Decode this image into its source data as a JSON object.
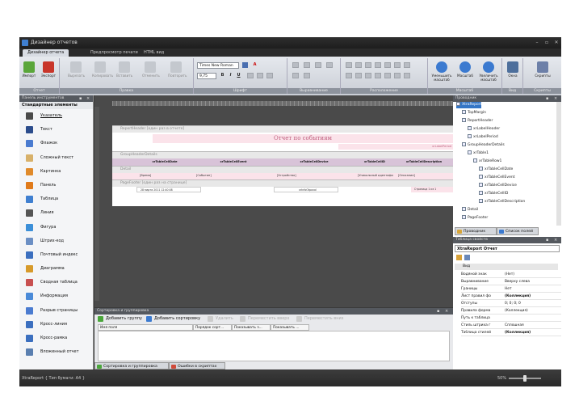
{
  "window": {
    "title": "Дизайнер отчетов",
    "controls": [
      "–",
      "▫",
      "✕"
    ]
  },
  "ribbon_tabs": [
    {
      "label": "Дизайнер отчета",
      "active": true
    },
    {
      "label": "Предпросмотр печати",
      "active": false
    },
    {
      "label": "HTML вид",
      "active": false
    }
  ],
  "ribbon": {
    "groups": {
      "report": "Отчет",
      "edit": "Правка",
      "font": "Шрифт",
      "align": "Выравнивание",
      "layout": "Расположение",
      "zoom": "Масштаб",
      "view": "Вид",
      "scripts": "Скрипты"
    },
    "buttons": {
      "import": "Импорт",
      "export": "Экспорт",
      "cut": "Вырезать",
      "copy": "Копировать",
      "paste": "Вставить",
      "undo": "Отменить",
      "redo": "Повторить",
      "zoom_out": "Уменьшить масштаб",
      "zoom": "Масштаб",
      "zoom_in": "Увеличить масштаб",
      "windows": "Окна",
      "scripts": "Скрипты"
    },
    "font_name": "Times New Roman",
    "font_size": "9,75",
    "style_buttons": [
      "B",
      "I",
      "U"
    ]
  },
  "toolbox": {
    "pane_title": "Панель инструментов",
    "header": "Стандартные элементы",
    "items": [
      {
        "label": "Указатель",
        "icon": "pointer-icon",
        "color": "#4a4a4a",
        "selected": true
      },
      {
        "label": "Текст",
        "icon": "text-icon",
        "color": "#2b4c8c"
      },
      {
        "label": "Флажок",
        "icon": "checkbox-icon",
        "color": "#4a7bd0"
      },
      {
        "label": "Сложный текст",
        "icon": "rich-text-icon",
        "color": "#d8b16a"
      },
      {
        "label": "Картинка",
        "icon": "picture-icon",
        "color": "#e08a2a"
      },
      {
        "label": "Панель",
        "icon": "panel-icon",
        "color": "#e07a1a"
      },
      {
        "label": "Таблица",
        "icon": "table-icon",
        "color": "#3f7fd0"
      },
      {
        "label": "Линия",
        "icon": "line-icon",
        "color": "#555555"
      },
      {
        "label": "Фигура",
        "icon": "shape-icon",
        "color": "#3b8fd8"
      },
      {
        "label": "Штрих-код",
        "icon": "barcode-icon",
        "color": "#6b8fc4"
      },
      {
        "label": "Почтовый индекс",
        "icon": "zipcode-icon",
        "color": "#3b6fbf"
      },
      {
        "label": "Диаграмма",
        "icon": "chart-icon",
        "color": "#d79a2a"
      },
      {
        "label": "Сводная таблица",
        "icon": "pivot-icon",
        "color": "#c85050"
      },
      {
        "label": "Информация",
        "icon": "info-icon",
        "color": "#4a8ad8"
      },
      {
        "label": "Разрыв страницы",
        "icon": "page-break-icon",
        "color": "#4a7bd0"
      },
      {
        "label": "Кросс-линия",
        "icon": "cross-line-icon",
        "color": "#3b6fbf"
      },
      {
        "label": "Кросс-рамка",
        "icon": "cross-band-icon",
        "color": "#3b6fbf"
      },
      {
        "label": "Вложенный отчет",
        "icon": "subreport-icon",
        "color": "#5a7fb0"
      }
    ]
  },
  "designer": {
    "bands": {
      "report_header": "ReportHeader [один раз в отчете]",
      "group_header": "GroupHeaderDetails",
      "detail": "Detail",
      "page_footer": "PageFooter [один раз на странице]"
    },
    "report_title": "Отчет по событиям",
    "label_period": "xrLabelPeriod",
    "table_header_cells": [
      "xrTableCellDate",
      "xrTableCellEvent",
      "xrTableCellDevice",
      "xrTableCellID",
      "xrTableCellDescription"
    ],
    "detail_cells": [
      "[Время]",
      "[Событие]",
      "[Устройство]",
      "[Уникальный идентифи",
      "[Описание]"
    ],
    "footer_date": "28 марта 2011 12:40:08",
    "footer_info": "xrInfoOtpoval",
    "footer_page": "Страница 1 из 1"
  },
  "sorting": {
    "title": "Сортировка и группировка",
    "add_group": "Добавить группу",
    "add_sort": "Добавить сортировку",
    "remove": "Удалить",
    "move_up": "Переместить вверх",
    "move_down": "Переместить вниз",
    "columns": [
      "Имя поля",
      "Порядок сорт...",
      "Показывать з...",
      "Показывать ..."
    ],
    "tabs": [
      "Сортировка и группировка",
      "Ошибки в скриптах"
    ]
  },
  "explorer": {
    "title": "Проводник",
    "tree": [
      {
        "label": "XtraReport",
        "indent": 0,
        "selected": true
      },
      {
        "label": "TopMargin",
        "indent": 1
      },
      {
        "label": "ReportHeader",
        "indent": 1
      },
      {
        "label": "xrLabelHeader",
        "indent": 2
      },
      {
        "label": "xrLabelPeriod",
        "indent": 2
      },
      {
        "label": "GroupHeaderDetails",
        "indent": 1
      },
      {
        "label": "xrTable1",
        "indent": 2
      },
      {
        "label": "xrTableRow1",
        "indent": 3
      },
      {
        "label": "xrTableCellDate",
        "indent": 4
      },
      {
        "label": "xrTableCellEvent",
        "indent": 4
      },
      {
        "label": "xrTableCellDevice",
        "indent": 4
      },
      {
        "label": "xrTableCellID",
        "indent": 4
      },
      {
        "label": "xrTableCellDescription",
        "indent": 4
      },
      {
        "label": "Detail",
        "indent": 1
      },
      {
        "label": "PageFooter",
        "indent": 1
      }
    ],
    "tabs": [
      "Проводник",
      "Список полей"
    ]
  },
  "properties": {
    "title": "Таблица свойств",
    "selected_object": "XtraReport  Отчет",
    "category": "Вид",
    "rows": [
      {
        "name": "Водяной знак",
        "value": "(Нет)"
      },
      {
        "name": "Выравнивание",
        "value": "Вверху слева"
      },
      {
        "name": "Границы",
        "value": "Нет"
      },
      {
        "name": "Лист правил фо",
        "value": "(Коллекция)",
        "bold": true
      },
      {
        "name": "Отступы",
        "value": "0; 0; 0; 0"
      },
      {
        "name": "Правила форма",
        "value": "(Коллекция)"
      },
      {
        "name": "Путь к таблица",
        "value": ""
      },
      {
        "name": "Стиль штриха г",
        "value": "Сплошная"
      },
      {
        "name": "Таблица стилей",
        "value": "(Коллекция)",
        "bold": true
      }
    ]
  },
  "status": {
    "left": "XtraReport { Тип бумаги: A4 }",
    "zoom": "50%",
    "zoom_fraction": 0.5
  }
}
